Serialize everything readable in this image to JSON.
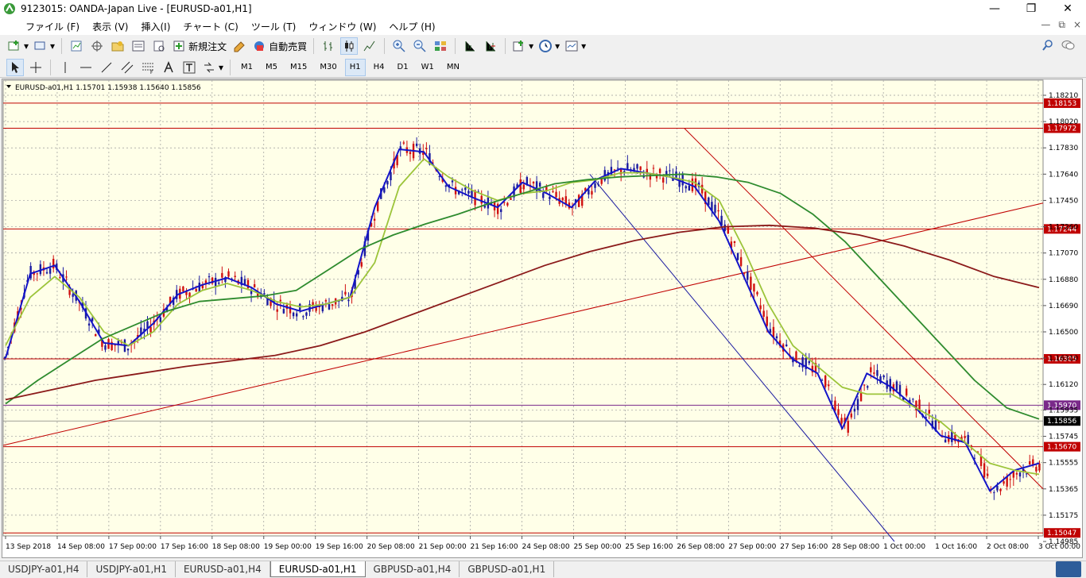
{
  "window": {
    "title": "9123015: OANDA-Japan Live - [EURUSD-a01,H1]",
    "controls": [
      "—",
      "❐",
      "✕"
    ]
  },
  "menu": {
    "items": [
      "ファイル (F)",
      "表示 (V)",
      "挿入(I)",
      "チャート (C)",
      "ツール (T)",
      "ウィンドウ (W)",
      "ヘルプ (H)"
    ],
    "right_controls": [
      "—",
      "⧉",
      "×"
    ]
  },
  "toolbar": {
    "new_order_label": "新規注文",
    "auto_trade_label": "自動売買",
    "timeframes": [
      "M1",
      "M5",
      "M15",
      "M30",
      "H1",
      "H4",
      "D1",
      "W1",
      "MN"
    ],
    "active_timeframe": "H1"
  },
  "tabs": {
    "items": [
      "USDJPY-a01,H4",
      "USDJPY-a01,H1",
      "EURUSD-a01,H4",
      "EURUSD-a01,H1",
      "GBPUSD-a01,H4",
      "GBPUSD-a01,H1"
    ],
    "active": "EURUSD-a01,H1"
  },
  "chart_data": {
    "type": "candlestick",
    "symbol": "EURUSD-a01,H1",
    "title": "EURUSD-a01,H1  1.15701 1.15938 1.15640 1.15856",
    "ohlc_header": {
      "open": 1.15701,
      "high": 1.15938,
      "low": 1.1564,
      "close": 1.15856
    },
    "current_price": 1.15856,
    "ylim": [
      1.14985,
      1.1821
    ],
    "y_ticks": [
      1.1821,
      1.1802,
      1.1783,
      1.1764,
      1.1745,
      1.1726,
      1.1707,
      1.1688,
      1.1669,
      1.165,
      1.1631,
      1.1612,
      1.15935,
      1.15745,
      1.15555,
      1.15365,
      1.15175,
      1.14985
    ],
    "x_labels": [
      "13 Sep 2018",
      "14 Sep 08:00",
      "17 Sep 00:00",
      "17 Sep 16:00",
      "18 Sep 08:00",
      "19 Sep 00:00",
      "19 Sep 16:00",
      "20 Sep 08:00",
      "21 Sep 00:00",
      "21 Sep 16:00",
      "24 Sep 08:00",
      "25 Sep 00:00",
      "25 Sep 16:00",
      "26 Sep 08:00",
      "27 Sep 00:00",
      "27 Sep 16:00",
      "28 Sep 08:00",
      "1 Oct 00:00",
      "1 Oct 16:00",
      "2 Oct 08:00",
      "3 Oct 00:00"
    ],
    "grid": true,
    "horizontal_lines": [
      {
        "price": 1.18153,
        "label": "1.18153",
        "color": "#c00000"
      },
      {
        "price": 1.17972,
        "label": "1.17972",
        "color": "#c00000"
      },
      {
        "price": 1.17244,
        "label": "1.17244",
        "color": "#c00000"
      },
      {
        "price": 1.16305,
        "label": "1.16305",
        "color": "#c00000"
      },
      {
        "price": 1.1597,
        "label": "1.15970",
        "color": "#7a2a8a"
      },
      {
        "price": 1.1567,
        "label": "1.15670",
        "color": "#c00000"
      },
      {
        "price": 1.15047,
        "label": "1.15047",
        "color": "#c00000"
      }
    ],
    "trendlines": [
      {
        "from": [
          0,
          1.1568
        ],
        "to": [
          1,
          1.17431
        ],
        "color": "#c00000"
      },
      {
        "from": [
          0.564,
          1.1764
        ],
        "to": [
          0.857,
          1.14985
        ],
        "color": "#1a1aa0"
      },
      {
        "from": [
          0.655,
          1.17972
        ],
        "to": [
          1,
          1.15365
        ],
        "color": "#c00000"
      }
    ],
    "series": [
      {
        "name": "MA fast",
        "color": "#1414c8",
        "values": [
          1.1631,
          1.1692,
          1.1698,
          1.1672,
          1.1642,
          1.164,
          1.1656,
          1.1677,
          1.1684,
          1.1689,
          1.1682,
          1.167,
          1.1665,
          1.167,
          1.1675,
          1.174,
          1.1782,
          1.178,
          1.1755,
          1.1747,
          1.174,
          1.1758,
          1.175,
          1.174,
          1.176,
          1.1768,
          1.1765,
          1.1762,
          1.1755,
          1.173,
          1.169,
          1.165,
          1.163,
          1.162,
          1.158,
          1.162,
          1.161,
          1.1595,
          1.1575,
          1.157,
          1.1535,
          1.155,
          1.1555
        ]
      },
      {
        "name": "MA medium",
        "color": "#9cc43a",
        "values": [
          1.164,
          1.1675,
          1.169,
          1.1675,
          1.165,
          1.164,
          1.165,
          1.167,
          1.168,
          1.1685,
          1.168,
          1.1672,
          1.1668,
          1.167,
          1.1675,
          1.17,
          1.1755,
          1.1775,
          1.1762,
          1.1752,
          1.1745,
          1.175,
          1.1752,
          1.1758,
          1.176,
          1.1765,
          1.1765,
          1.1762,
          1.1758,
          1.1745,
          1.171,
          1.167,
          1.164,
          1.1625,
          1.161,
          1.1605,
          1.1605,
          1.1595,
          1.1585,
          1.157,
          1.1555,
          1.155,
          1.1547
        ]
      },
      {
        "name": "MA slow",
        "color": "#2e8b2e",
        "values": [
          1.1598,
          1.1615,
          1.163,
          1.1645,
          1.1655,
          1.1665,
          1.1672,
          1.1674,
          1.1676,
          1.168,
          1.1695,
          1.171,
          1.172,
          1.1728,
          1.1735,
          1.1743,
          1.175,
          1.1757,
          1.176,
          1.1762,
          1.1763,
          1.1764,
          1.1762,
          1.1758,
          1.175,
          1.1735,
          1.1715,
          1.169,
          1.1665,
          1.164,
          1.1615,
          1.1595,
          1.1587
        ]
      },
      {
        "name": "MA 200",
        "color": "#8b1a1a",
        "values": [
          1.1601,
          1.1608,
          1.1615,
          1.162,
          1.1625,
          1.1629,
          1.1633,
          1.164,
          1.165,
          1.1662,
          1.1674,
          1.1686,
          1.1698,
          1.1708,
          1.1716,
          1.1722,
          1.1726,
          1.1727,
          1.1725,
          1.172,
          1.1712,
          1.1702,
          1.169,
          1.1682
        ]
      }
    ]
  }
}
